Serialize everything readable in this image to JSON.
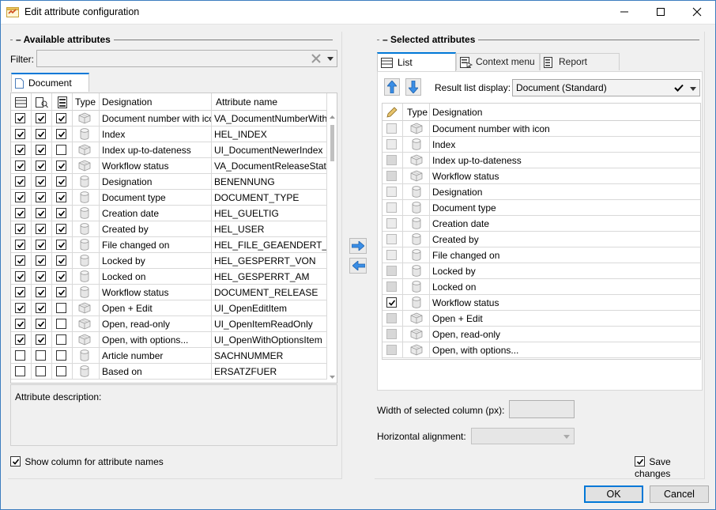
{
  "window": {
    "title": "Edit attribute configuration",
    "icon": "app-config-icon",
    "controls": [
      "minimize-icon",
      "maximize-icon",
      "close-icon"
    ]
  },
  "available": {
    "group_title": "Available attributes",
    "filter_label": "Filter:",
    "filter_value": "",
    "tab_label": "Document",
    "headers": {
      "type": "Type",
      "designation": "Designation",
      "attribute_name": "Attribute name"
    },
    "rows": [
      {
        "c1": true,
        "c2": true,
        "c3": true,
        "icon": "cube",
        "designation": "Document number with icon",
        "attr": "VA_DocumentNumberWithIcon"
      },
      {
        "c1": true,
        "c2": true,
        "c3": true,
        "icon": "cyl",
        "designation": "Index",
        "attr": "HEL_INDEX"
      },
      {
        "c1": true,
        "c2": true,
        "c3": false,
        "icon": "cube",
        "designation": "Index up-to-dateness",
        "attr": "UI_DocumentNewerIndex"
      },
      {
        "c1": true,
        "c2": true,
        "c3": true,
        "icon": "cube",
        "designation": "Workflow status",
        "attr": "VA_DocumentReleaseStatus"
      },
      {
        "c1": true,
        "c2": true,
        "c3": true,
        "icon": "cyl",
        "designation": "Designation",
        "attr": "BENENNUNG"
      },
      {
        "c1": true,
        "c2": true,
        "c3": true,
        "icon": "cyl",
        "designation": "Document type",
        "attr": "DOCUMENT_TYPE"
      },
      {
        "c1": true,
        "c2": true,
        "c3": true,
        "icon": "cyl",
        "designation": "Creation date",
        "attr": "HEL_GUELTIG"
      },
      {
        "c1": true,
        "c2": true,
        "c3": true,
        "icon": "cyl",
        "designation": "Created by",
        "attr": "HEL_USER"
      },
      {
        "c1": true,
        "c2": true,
        "c3": true,
        "icon": "cyl",
        "designation": "File changed on",
        "attr": "HEL_FILE_GEAENDERT_DATUM"
      },
      {
        "c1": true,
        "c2": true,
        "c3": true,
        "icon": "cyl",
        "designation": "Locked by",
        "attr": "HEL_GESPERRT_VON"
      },
      {
        "c1": true,
        "c2": true,
        "c3": true,
        "icon": "cyl",
        "designation": "Locked on",
        "attr": "HEL_GESPERRT_AM"
      },
      {
        "c1": true,
        "c2": true,
        "c3": true,
        "icon": "cyl",
        "designation": "Workflow status",
        "attr": "DOCUMENT_RELEASE"
      },
      {
        "c1": true,
        "c2": true,
        "c3": false,
        "icon": "cube",
        "designation": "Open + Edit",
        "attr": "UI_OpenEditItem"
      },
      {
        "c1": true,
        "c2": true,
        "c3": false,
        "icon": "cube",
        "designation": "Open, read-only",
        "attr": "UI_OpenItemReadOnly"
      },
      {
        "c1": true,
        "c2": true,
        "c3": false,
        "icon": "cube",
        "designation": "Open, with options...",
        "attr": "UI_OpenWithOptionsItem"
      },
      {
        "c1": false,
        "c2": false,
        "c3": false,
        "icon": "cyl",
        "designation": "Article number",
        "attr": "SACHNUMMER"
      },
      {
        "c1": false,
        "c2": false,
        "c3": false,
        "icon": "cyl",
        "designation": "Based on",
        "attr": "ERSATZFUER"
      }
    ],
    "description_label": "Attribute description:",
    "show_column_label": "Show column for attribute names",
    "show_column_checked": true
  },
  "selected": {
    "group_title": "Selected attributes",
    "tabs": [
      {
        "label": "List",
        "icon": "list-icon",
        "active": true
      },
      {
        "label": "Context menu",
        "icon": "context-menu-icon",
        "active": false
      },
      {
        "label": "Report",
        "icon": "report-icon",
        "active": false
      }
    ],
    "result_list_label": "Result list display:",
    "result_list_value": "Document (Standard)",
    "headers": {
      "type": "Type",
      "designation": "Designation"
    },
    "rows": [
      {
        "checked": false,
        "icon": "cube",
        "designation": "Document number with icon",
        "style": "dis"
      },
      {
        "checked": false,
        "icon": "cyl",
        "designation": "Index",
        "style": "dis"
      },
      {
        "checked": false,
        "icon": "cube",
        "designation": "Index up-to-dateness",
        "style": "dis2"
      },
      {
        "checked": false,
        "icon": "cube",
        "designation": "Workflow status",
        "style": "dis2"
      },
      {
        "checked": false,
        "icon": "cyl",
        "designation": "Designation",
        "style": "dis"
      },
      {
        "checked": false,
        "icon": "cyl",
        "designation": "Document type",
        "style": "dis"
      },
      {
        "checked": false,
        "icon": "cyl",
        "designation": "Creation date",
        "style": "dis"
      },
      {
        "checked": false,
        "icon": "cyl",
        "designation": "Created by",
        "style": "dis"
      },
      {
        "checked": false,
        "icon": "cyl",
        "designation": "File changed on",
        "style": "dis"
      },
      {
        "checked": false,
        "icon": "cyl",
        "designation": "Locked by",
        "style": "dis2"
      },
      {
        "checked": false,
        "icon": "cyl",
        "designation": "Locked on",
        "style": "dis2"
      },
      {
        "checked": true,
        "icon": "cyl",
        "designation": "Workflow status",
        "style": "normal"
      },
      {
        "checked": false,
        "icon": "cube",
        "designation": "Open + Edit",
        "style": "dis2"
      },
      {
        "checked": false,
        "icon": "cube",
        "designation": "Open, read-only",
        "style": "dis2"
      },
      {
        "checked": false,
        "icon": "cube",
        "designation": "Open, with options...",
        "style": "dis2"
      }
    ],
    "width_label": "Width of selected column (px):",
    "width_value": "",
    "alignment_label": "Horizontal alignment:",
    "alignment_value": "",
    "save_changes_label": "Save changes",
    "save_changes_checked": true
  },
  "buttons": {
    "ok": "OK",
    "cancel": "Cancel"
  },
  "colors": {
    "accent": "#0078d7",
    "arrow_blue": "#3a8ee6",
    "window_border": "#3c7dbf"
  }
}
